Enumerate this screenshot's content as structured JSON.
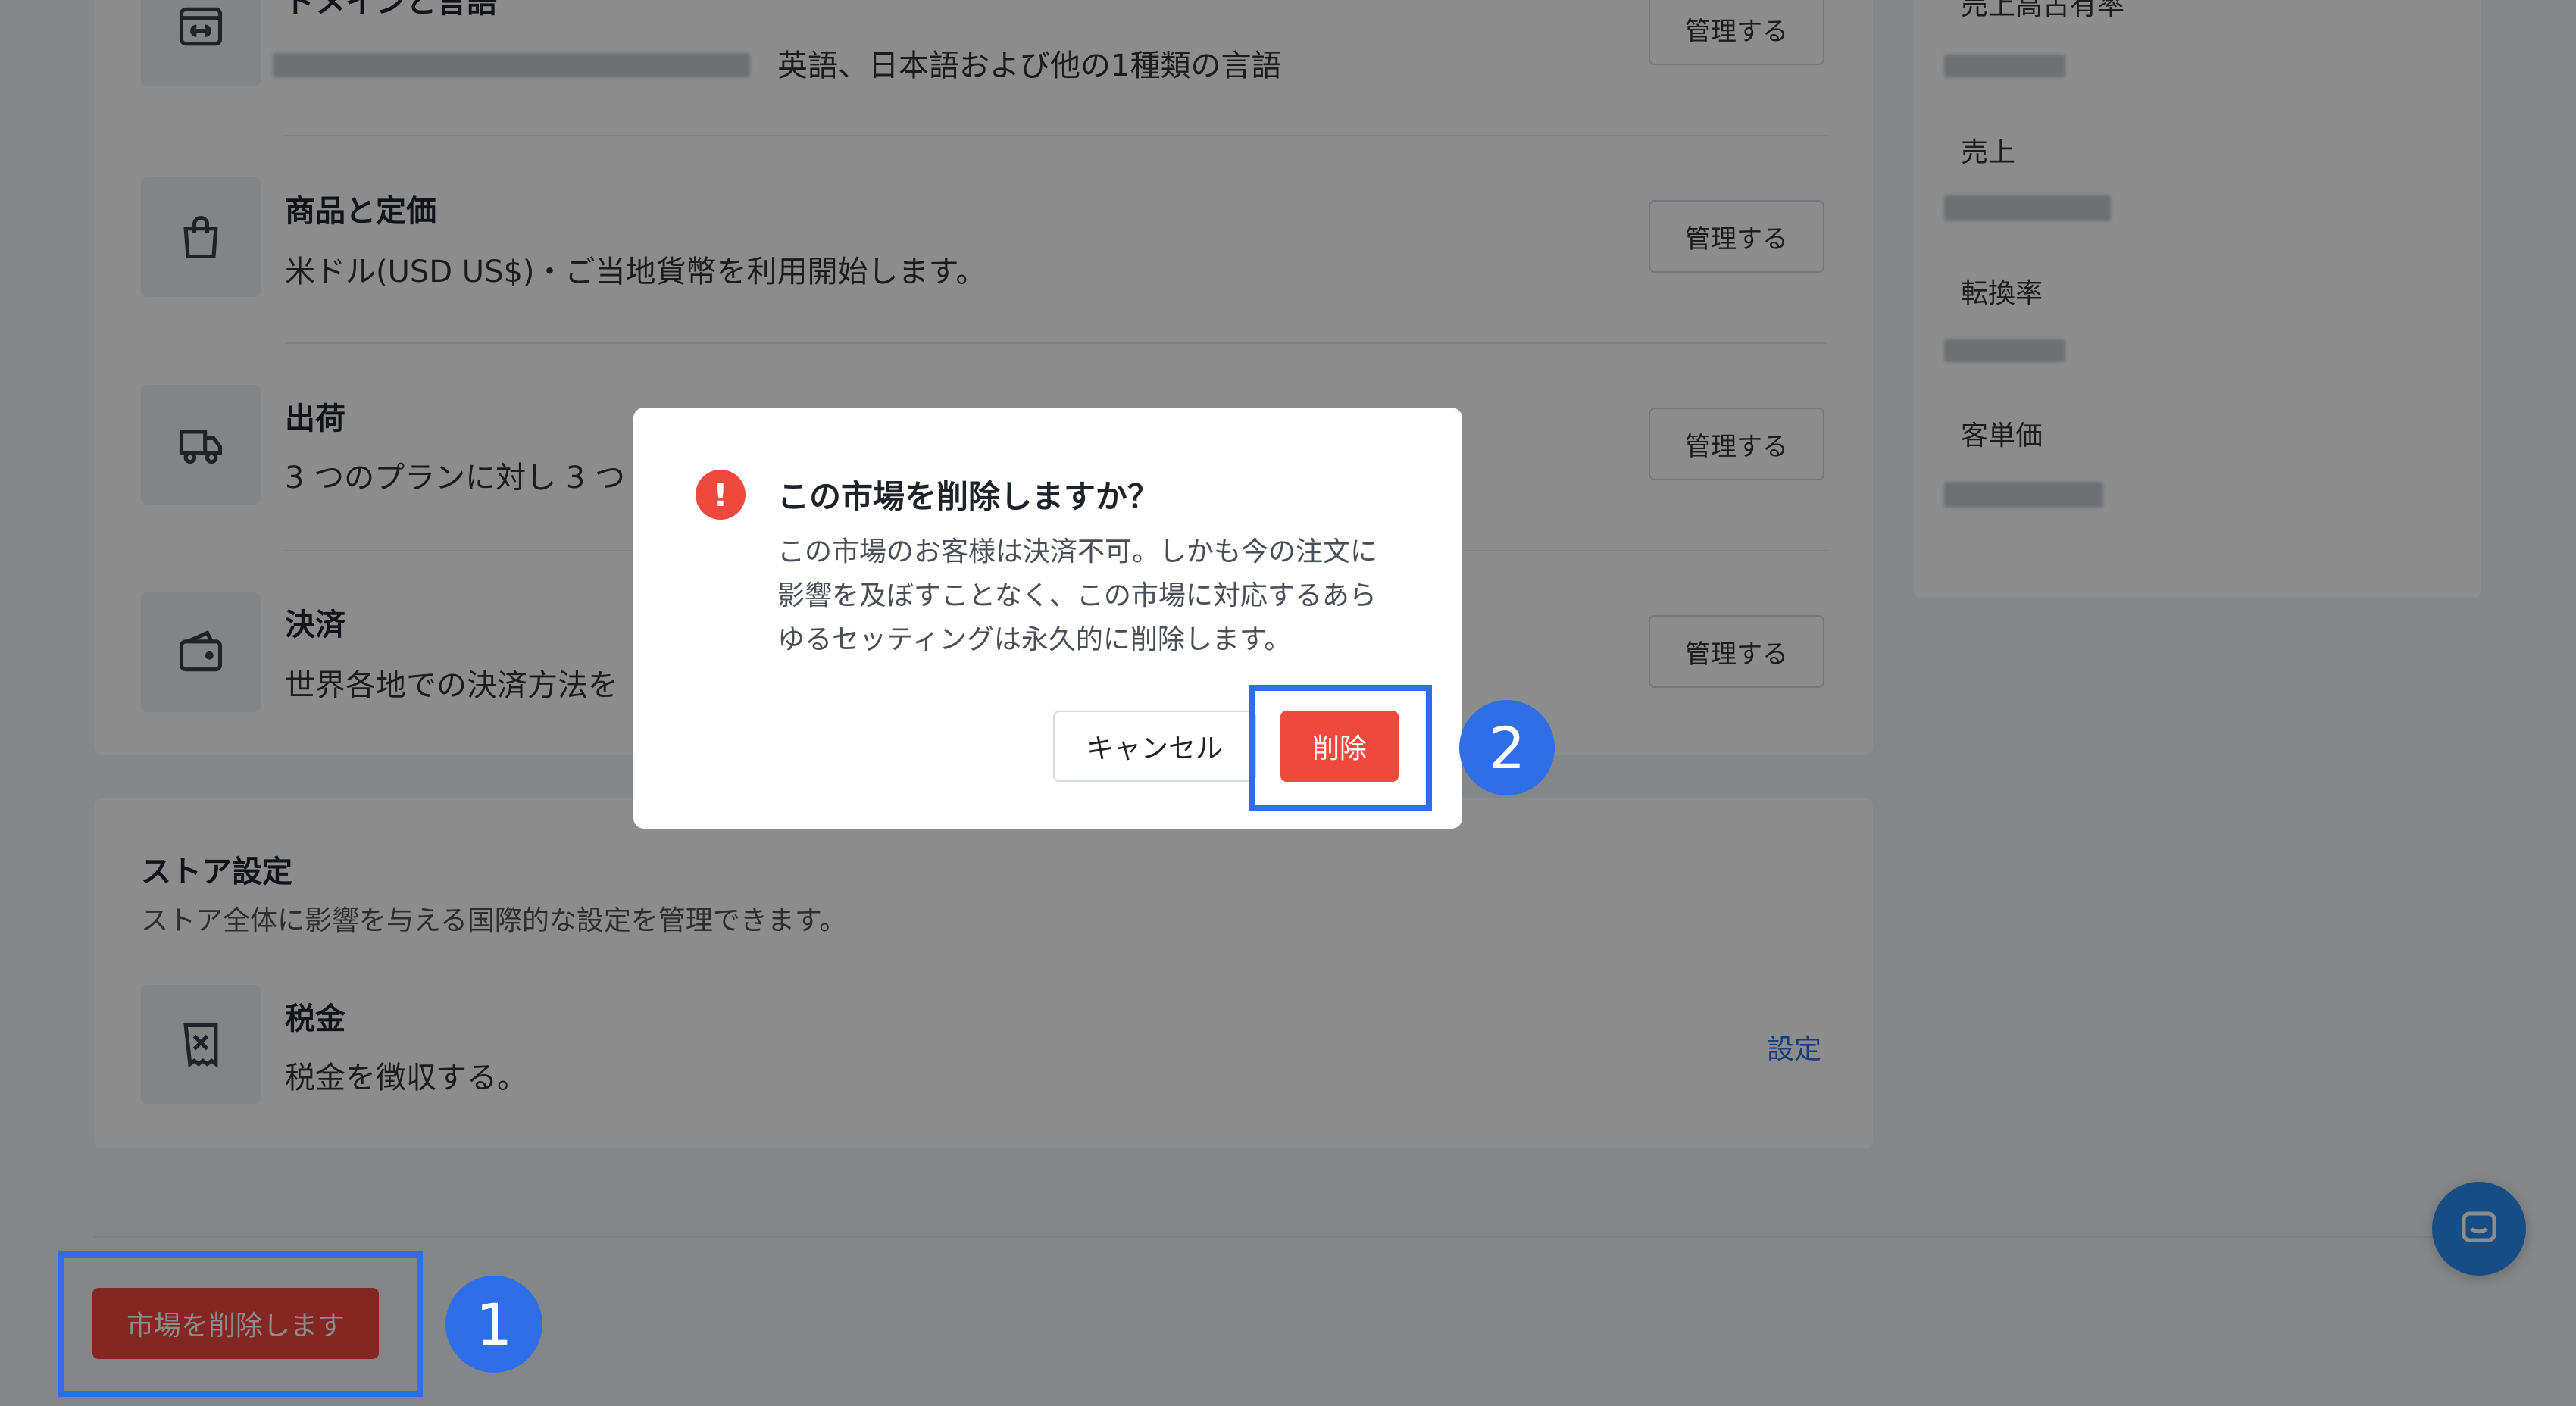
{
  "market_settings": {
    "domain_language": {
      "title": "ドメインと言語",
      "desc": "英語、日本語および他の1種類の言語",
      "manage_label": "管理する"
    },
    "products_pricing": {
      "title": "商品と定価",
      "desc": "米ドル(USD US$)・ご当地貨幣を利用開始します。",
      "manage_label": "管理する"
    },
    "shipping": {
      "title": "出荷",
      "desc": "3 つのプランに対し 3 つ",
      "manage_label": "管理する"
    },
    "payment": {
      "title": "決済",
      "desc": "世界各地での決済方法を",
      "manage_label": "管理する"
    }
  },
  "store_settings": {
    "heading": "ストア設定",
    "subheading": "ストア全体に影響を与える国際的な設定を管理できます。",
    "tax": {
      "title": "税金",
      "desc": "税金を徴収する。",
      "link_label": "設定"
    }
  },
  "side_panel": {
    "labels": [
      "売上高占有率",
      "売上",
      "転換率",
      "客単価"
    ]
  },
  "footer": {
    "delete_market_label": "市場を削除します"
  },
  "modal": {
    "title": "この市場を削除しますか？",
    "body": "この市場のお客様は決済不可。しかも今の注文に影響を及ぼすことなく、この市場に対応するあらゆるセッティングは永久的に削除します。",
    "cancel_label": "キャンセル",
    "delete_label": "削除",
    "alert_glyph": "!"
  },
  "annotations": {
    "step1": "1",
    "step2": "2"
  },
  "colors": {
    "accent": "#2f6ee9",
    "danger": "#f0483e",
    "chat": "#2b8cf2"
  },
  "icons": {
    "domain": "domain-link-icon",
    "products": "shopping-bag-icon",
    "shipping": "truck-icon",
    "payment": "wallet-icon",
    "tax": "receipt-icon",
    "alert": "alert-icon",
    "chat": "chat-icon"
  }
}
